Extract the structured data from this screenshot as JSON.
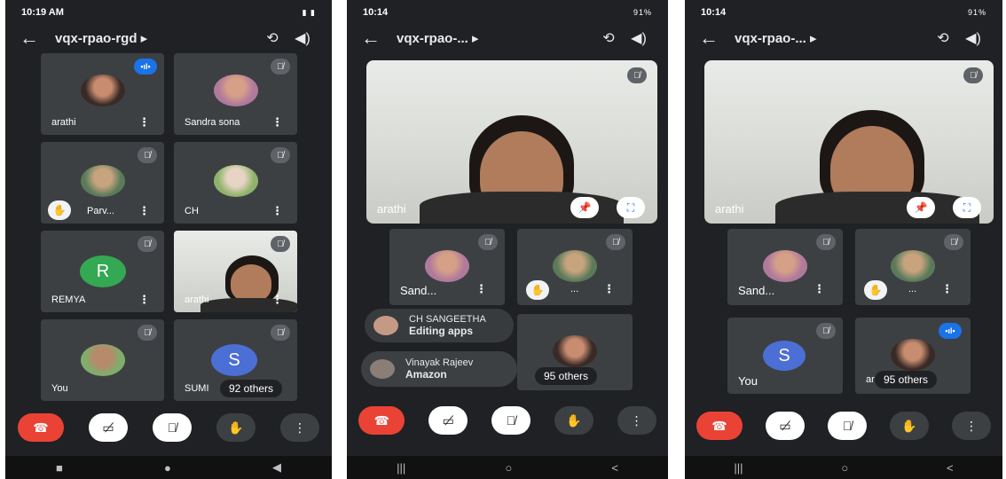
{
  "phone1": {
    "status_time": "10:19 AM",
    "status_right": "▮ ▮",
    "meeting_title": "vqx-rpao-rgd ▸",
    "icons": {
      "back": "←",
      "switch_camera": "⟲",
      "speaker": "◀)"
    },
    "tiles": [
      {
        "name": "arathi",
        "speaking": "•ıl•"
      },
      {
        "name": "Sandra sona"
      },
      {
        "name": "Parv..."
      },
      {
        "name": "CH"
      },
      {
        "name": "REMYA",
        "letter": "R"
      },
      {
        "name": "arathi"
      },
      {
        "name": "You"
      },
      {
        "name": "SUMI",
        "letter": "S"
      }
    ],
    "others": "92 others"
  },
  "phone2": {
    "status_time": "10:14",
    "status_right": "91%",
    "meeting_title": "vqx-rpao-... ▸",
    "main_name": "arathi",
    "tiles": [
      {
        "name": "Sand..."
      },
      {
        "name": "..."
      }
    ],
    "toast1": {
      "name": "CH SANGEETHA",
      "text": "Editing apps"
    },
    "toast2": {
      "name": "Vinayak Rajeev",
      "text": "Amazon"
    },
    "others": "95 others"
  },
  "phone3": {
    "status_time": "10:14",
    "status_right": "91%",
    "meeting_title": "vqx-rpao-... ▸",
    "main_name": "arathi",
    "tiles": [
      {
        "name": "Sand..."
      },
      {
        "name": "..."
      },
      {
        "name": "You",
        "letter": "S"
      },
      {
        "name": "ar",
        "speaking": "•ıl•"
      }
    ],
    "others": "95 others"
  },
  "common": {
    "kebab": "⋮",
    "mute": "🎙̸",
    "hand": "✋",
    "pin": "📌",
    "fullscreen": "⛶",
    "controls": {
      "end": "☎",
      "camera": "▭̸",
      "mic": "🎙̸",
      "hand": "✋",
      "more": "⋮"
    },
    "nav_samsung": {
      "recent": "|||",
      "home": "○",
      "back": "<"
    },
    "nav_android": {
      "recent": "■",
      "home": "●",
      "back": "◀"
    }
  },
  "colors": {
    "bg": "#202124",
    "tile": "#3c4043",
    "end_call": "#ea4335",
    "speaking": "#1a73e8",
    "avatar_r": "#34a853",
    "avatar_s": "#4c6fd6"
  }
}
